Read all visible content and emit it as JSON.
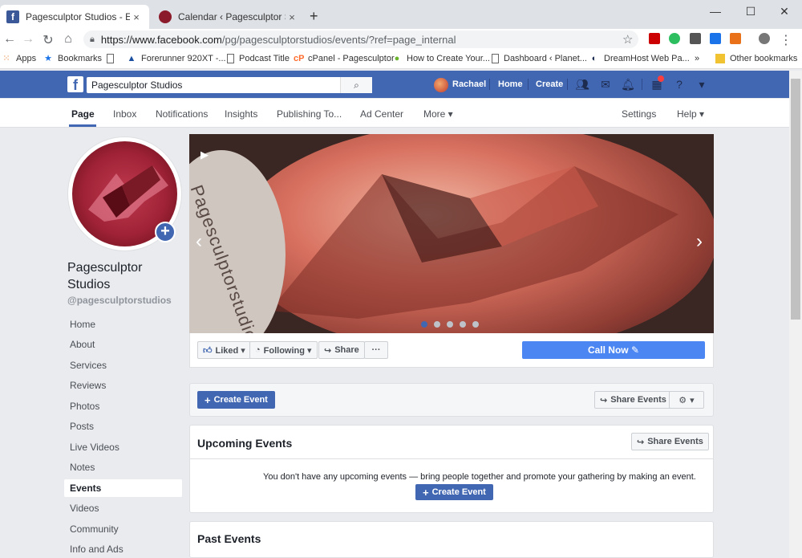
{
  "browser": {
    "tabs": [
      {
        "title": "Pagesculptor Studios - Events",
        "close": "×"
      },
      {
        "title": "Calendar ‹ Pagesculptor Studios –",
        "close": "×"
      }
    ],
    "new_tab": "+",
    "window_controls": [
      "—",
      "☐",
      "✕"
    ],
    "url_main": "https://www.facebook.com",
    "url_rest": "/pg/pagesculptorstudios/events/?ref=page_internal",
    "bookmarks": [
      {
        "label": "Apps",
        "icon": "apps-grid-icon",
        "glyph": "⋮"
      },
      {
        "label": "Bookmarks",
        "icon": "star-icon",
        "glyph": "★"
      },
      {
        "label": "",
        "icon": "page-icon",
        "glyph": "▯"
      },
      {
        "label": "Forerunner 920XT -...",
        "icon": "triangle-icon",
        "glyph": "▲"
      },
      {
        "label": "Podcast Title",
        "icon": "page-icon",
        "glyph": "▯"
      },
      {
        "label": "cPanel - Pagesculptor",
        "icon": "cpanel-icon",
        "glyph": "cP"
      },
      {
        "label": "How to Create Your...",
        "icon": "leaf-icon",
        "glyph": "●"
      },
      {
        "label": "Dashboard ‹ Planet...",
        "icon": "page-icon",
        "glyph": "▯"
      },
      {
        "label": "DreamHost Web Pa...",
        "icon": "dreamhost-icon",
        "glyph": "◐"
      }
    ],
    "bookmarks_overflow": "»",
    "other_bookmarks": "Other bookmarks"
  },
  "fb": {
    "logo": "f",
    "search_value": "Pagesculptor Studios",
    "user_name": "Rachael",
    "home": "Home",
    "create": "Create"
  },
  "page_nav": {
    "items": [
      "Page",
      "Inbox",
      "Notifications",
      "Insights",
      "Publishing To...",
      "Ad Center",
      "More ▾"
    ],
    "settings": "Settings",
    "help": "Help ▾"
  },
  "profile": {
    "name": "Pagesculptor Studios",
    "handle": "@pagesculptorstudios",
    "add": "+"
  },
  "left_nav": [
    "Home",
    "About",
    "Services",
    "Reviews",
    "Photos",
    "Posts",
    "Live Videos",
    "Notes",
    "Events",
    "Videos",
    "Community",
    "Info and Ads"
  ],
  "cover": {
    "rim_text": "Pagesculptorstudios",
    "prev": "‹",
    "next": "›",
    "slide_count": 5,
    "current_slide": 1
  },
  "actions": {
    "liked": "Liked ▾",
    "following": "Following ▾",
    "share": "Share",
    "more": "···",
    "call_now": "Call Now ✎"
  },
  "events": {
    "create_event": "Create Event",
    "share_events": "Share Events",
    "settings_caret": "▾",
    "upcoming_title": "Upcoming Events",
    "empty_text": "You don't have any upcoming events — bring people together and promote your gathering by making an event.",
    "past_title": "Past Events"
  },
  "colors": {
    "fb_blue": "#4267b2",
    "call_now_blue": "#4b86f3"
  }
}
